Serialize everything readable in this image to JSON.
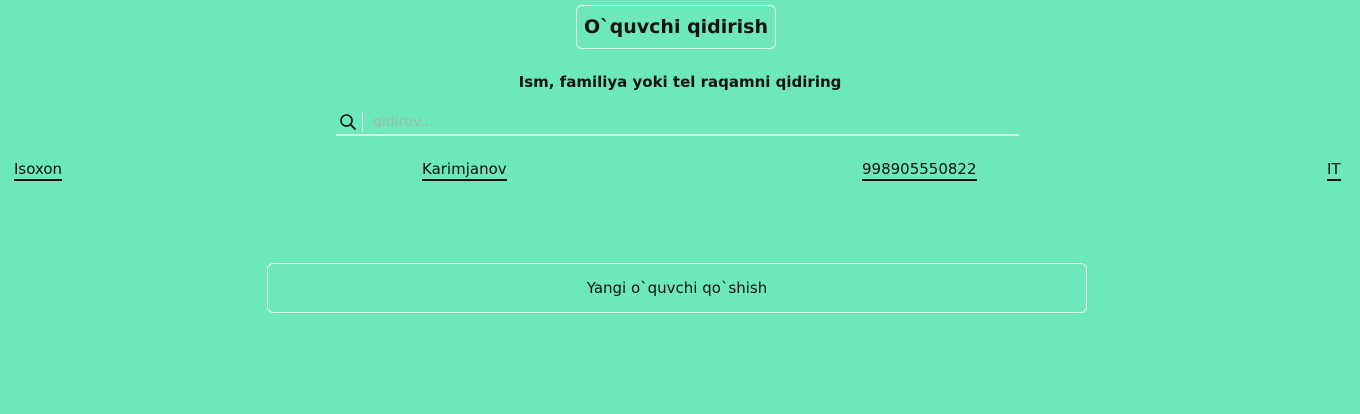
{
  "header": {
    "title": "O`quvchi qidirish",
    "subtitle": "Ism, familiya yoki tel raqamni qidiring"
  },
  "search": {
    "icon": "search-icon",
    "placeholder": "qidiruv...",
    "value": ""
  },
  "students": [
    {
      "first_name": "Isoxon",
      "last_name": "Karimjanov",
      "phone": "998905550822",
      "group": "IT"
    }
  ],
  "actions": {
    "add_student_label": "Yangi o`quvchi qo`shish"
  },
  "colors": {
    "background": "#6de8b9",
    "border": "#e6f5ef",
    "text": "#111111"
  }
}
